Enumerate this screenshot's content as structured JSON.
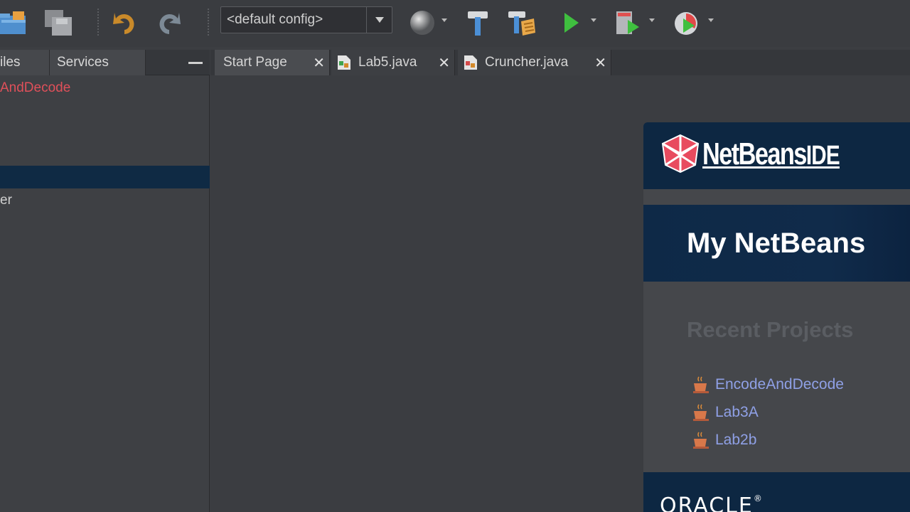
{
  "toolbar": {
    "config_value": "<default config>",
    "buttons": [
      "open-project",
      "save-all",
      "undo",
      "redo",
      "browser",
      "build",
      "clean-build",
      "run",
      "profile",
      "debug"
    ]
  },
  "left_panel": {
    "tabs": [
      {
        "label": "iles"
      },
      {
        "label": "Services"
      }
    ],
    "items": [
      {
        "label": "AndDecode"
      },
      {
        "label": "er"
      }
    ]
  },
  "editor_tabs": [
    {
      "label": "Start Page"
    },
    {
      "label": "Lab5.java"
    },
    {
      "label": "Cruncher.java"
    }
  ],
  "start_page": {
    "logo_brand": "NetBeans",
    "logo_suffix": "IDE",
    "title": "My NetBeans",
    "recent_title": "Recent Projects",
    "recent_projects": [
      {
        "label": "EncodeAndDecode"
      },
      {
        "label": "Lab3A"
      },
      {
        "label": "Lab2b"
      }
    ],
    "footer_brand": "ORACLE",
    "footer_mark": "®"
  },
  "colors": {
    "background": "#3c3e42",
    "accent_navy": "#0d2742",
    "link": "#8fa0e6",
    "error_red": "#e0505a",
    "run_green": "#3fbf3f"
  }
}
